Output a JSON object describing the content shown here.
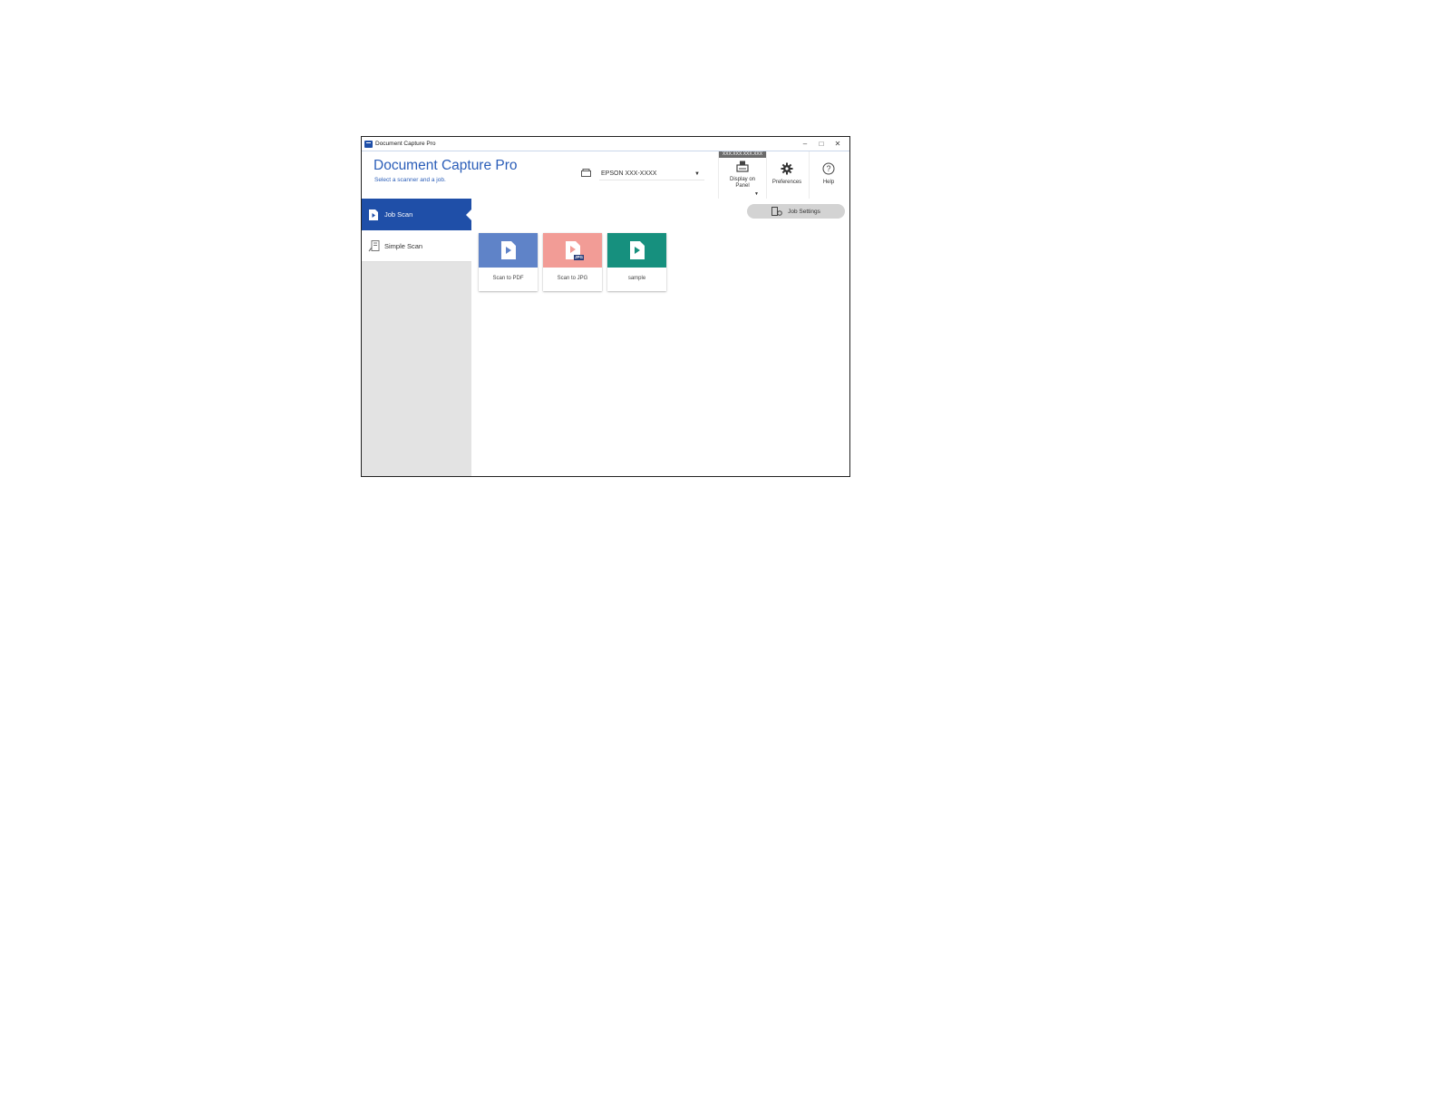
{
  "window": {
    "title": "Document Capture Pro",
    "controls": {
      "minimize": "–",
      "maximize": "□",
      "close": "✕"
    }
  },
  "header": {
    "title": "Document Capture Pro",
    "subtitle": "Select a scanner and a job.",
    "scanner": {
      "value": "EPSON  XXX-XXXX",
      "icon": "scanner-icon"
    }
  },
  "toolbar": {
    "display_on_panel": {
      "ip": "XXX.XXX.XXX.XXX",
      "label_line1": "Display on",
      "label_line2": "Panel",
      "icon": "panel-display-icon"
    },
    "preferences": {
      "label": "Preferences",
      "icon": "gear-icon"
    },
    "help": {
      "label": "Help",
      "icon": "help-icon"
    }
  },
  "sidebar": {
    "items": [
      {
        "label": "Job Scan",
        "icon": "job-scan-icon",
        "active": true
      },
      {
        "label": "Simple Scan",
        "icon": "simple-scan-icon",
        "active": false
      }
    ]
  },
  "main": {
    "job_settings_label": "Job Settings",
    "jobs": [
      {
        "label": "Scan to PDF",
        "color": "#5f83c8",
        "icon": "document-play-icon"
      },
      {
        "label": "Scan to JPG",
        "color": "#f29c96",
        "icon": "document-jpg-icon",
        "tag": "JPG"
      },
      {
        "label": "sample",
        "color": "#16907e",
        "icon": "document-play-icon"
      }
    ]
  }
}
